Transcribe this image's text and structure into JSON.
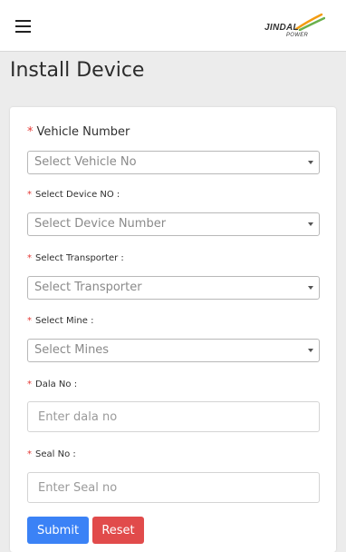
{
  "header": {
    "menu_icon": "hamburger-icon",
    "logo": {
      "name": "JINDAL",
      "sub": "POWER",
      "icon": "jindal-power-logo"
    }
  },
  "page": {
    "title": "Install Device"
  },
  "form": {
    "vehicle": {
      "label": "Vehicle Number",
      "value": "Select Vehicle No"
    },
    "device": {
      "label": "Select Device NO :",
      "value": "Select Device Number"
    },
    "transporter": {
      "label": "Select Transporter :",
      "value": "Select Transporter"
    },
    "mine": {
      "label": "Select Mine :",
      "value": "Select Mines"
    },
    "dala": {
      "label": "Dala No :",
      "placeholder": "Enter dala no"
    },
    "seal": {
      "label": "Seal No :",
      "placeholder": "Enter Seal no"
    },
    "required_mark": "*",
    "submit_label": "Submit",
    "reset_label": "Reset"
  },
  "colors": {
    "required": "#e53935",
    "submit": "#3b82f6",
    "reset": "#e14b4b",
    "logo_green": "#6ab04c",
    "logo_orange": "#f39c12"
  }
}
